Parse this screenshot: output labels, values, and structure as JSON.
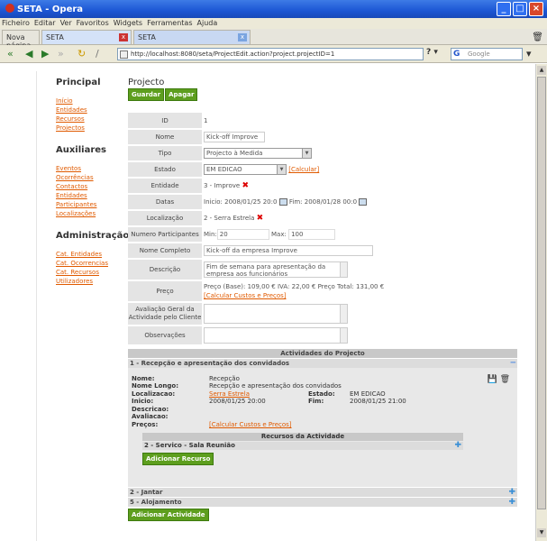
{
  "window": {
    "title": "SETA - Opera"
  },
  "menu": [
    "Ficheiro",
    "Editar",
    "Ver",
    "Favoritos",
    "Widgets",
    "Ferramentas",
    "Ajuda"
  ],
  "tabs": [
    {
      "label": "Nova página"
    },
    {
      "label": "SETA"
    },
    {
      "label": "SETA"
    }
  ],
  "address": {
    "url": "http://localhost:8080/seta/ProjectEdit.action?project.projectID=1",
    "search_placeholder": "Google"
  },
  "sidebar": {
    "principal": {
      "title": "Principal",
      "items": [
        "Início",
        "Entidades",
        "Recursos",
        "Projectos"
      ]
    },
    "auxiliares": {
      "title": "Auxiliares",
      "items": [
        "Eventos",
        "Ocorrências",
        "Contactos",
        "Entidades",
        "Participantes",
        "Localizações"
      ]
    },
    "admin": {
      "title": "Administração",
      "items": [
        "Cat. Entidades",
        "Cat. Ocorrencias",
        "Cat. Recursos",
        "Utilizadores"
      ]
    }
  },
  "form": {
    "title": "Projecto",
    "save": "Guardar",
    "delete": "Apagar",
    "id_label": "ID",
    "id": "1",
    "nome_label": "Nome",
    "nome": "Kick-off Improve",
    "tipo_label": "Tipo",
    "tipo": "Projecto à Medida",
    "estado_label": "Estado",
    "estado": "EM EDICAO",
    "calcular": "[Calcular]",
    "entidade_label": "Entidade",
    "entidade": "3 - Improve",
    "datas_label": "Datas",
    "inicio_label": "Inicio:",
    "inicio": "2008/01/25 20:0",
    "fim_label": "Fim:",
    "fim": "2008/01/28 00:0",
    "localizacao_label": "Localização",
    "localizacao": "2 - Serra Estrela",
    "participantes_label": "Numero Participantes",
    "min_label": "Min:",
    "min": "20",
    "max_label": "Max:",
    "max": "100",
    "nome_completo_label": "Nome Completo",
    "nome_completo": "Kick-off da empresa Improve",
    "descricao_label": "Descrição",
    "descricao": "Fim de semana para apresentação da empresa aos funcionários",
    "preco_label": "Preço",
    "preco": "Preço (Base): 109,00 € IVA: 22,00 € Preço Total: 131,00 €",
    "calcular_custos": "[Calcular Custos e Preços]",
    "avaliacao_label": "Avaliação Geral da Actividade pelo Cliente",
    "observacoes_label": "Observações"
  },
  "activities": {
    "header": "Actividades do Projecto",
    "first": {
      "title": "1 - Recepção e apresentação dos convidados",
      "nome_k": "Nome:",
      "nome": "Recepção",
      "nomelongo_k": "Nome Longo:",
      "nomelongo": "Recepção e apresentação dos convidados",
      "loc_k": "Localizacao:",
      "loc": "Serra Estrela",
      "estado_k": "Estado:",
      "estado": "EM EDICAO",
      "inicio_k": "Inicio:",
      "inicio": "2008/01/25 20:00",
      "fim_k": "Fim:",
      "fim": "2008/01/25 21:00",
      "descricao_k": "Descricao:",
      "avaliacao_k": "Avaliacao:",
      "precos_k": "Preços:",
      "calcular": "[Calcular Custos e Preços]",
      "resources_header": "Recursos da Actividade",
      "resource": "2 - Servico - Sala Reunião",
      "add_resource": "Adicionar Recurso"
    },
    "others": [
      "2 - Jantar",
      "5 - Alojamento"
    ],
    "add_activity": "Adicionar Actividade"
  }
}
